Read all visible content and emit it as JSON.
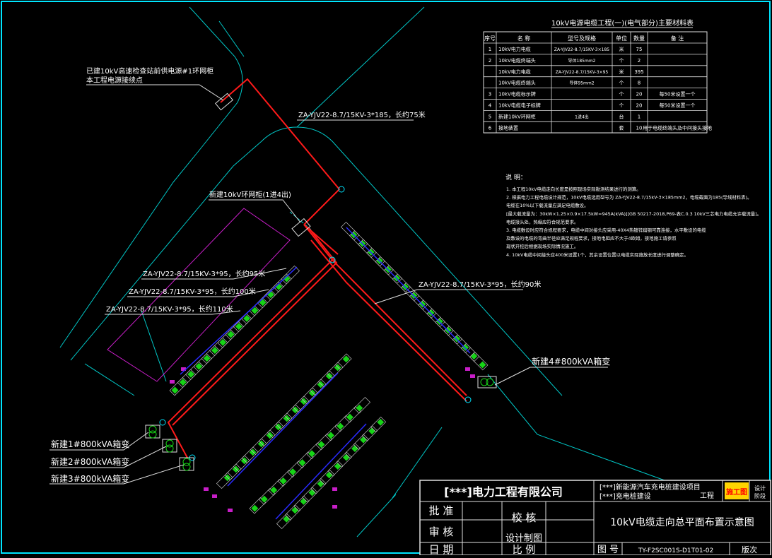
{
  "colors": {
    "background": "#000000",
    "frame": "#00e5ff",
    "road": "#00c8c8",
    "cable": "#ff1a1a",
    "cable_bus": "#2a2aff",
    "parking": "#e0e0e0",
    "charger": "#17d417",
    "site_boundary": "#c81ec8",
    "text": "#ffffff",
    "callout": "#ffff66",
    "stamp_fill": "#ffd400",
    "stamp_text": "#ff0000"
  },
  "labels": {
    "existing_ring_main": [
      "已建10kV高速检查站前供电源#1环网柜",
      "本工程电源接续点"
    ],
    "cable_main": "ZA-YJV22-8.7/15KV-3*185，长约75米",
    "new_ring_main": "新建10kV环网柜(1进4出)",
    "cable_a": "ZA-YJV22-8.7/15KV-3*95，长约95米",
    "cable_b": "ZA-YJV22-8.7/15KV-3*95，长约100米",
    "cable_c": "ZA-YJV22-8.7/15KV-3*95，长约110米",
    "cable_d": "ZA-YJV22-8.7/15KV-3*95，长约90米",
    "transformer_4": "新建4#800kVA箱变",
    "transformer_1": "新建1#800kVA箱变",
    "transformer_2": "新建2#800kVA箱变",
    "transformer_3": "新建3#800kVA箱变"
  },
  "material_table": {
    "title": "10kV电源电缆工程(一)(电气部分)主要材料表",
    "headers": [
      "序号",
      "名 称",
      "型号及规格",
      "单位",
      "数量",
      "备 注"
    ],
    "rows": [
      [
        "1",
        "10kV电力电缆",
        "ZA-YJV22-8.7/15KV-3×185",
        "米",
        "75",
        ""
      ],
      [
        "2",
        "10kV电缆终端头",
        "导体185mm2",
        "个",
        "2",
        ""
      ],
      [
        "",
        "10kV电力电缆",
        "ZA-YJV22-8.7/15KV-3×95",
        "米",
        "395",
        ""
      ],
      [
        "",
        "10kV电缆终端头",
        "导体95mm2",
        "个",
        "8",
        ""
      ],
      [
        "3",
        "10kV电缆标示牌",
        "",
        "个",
        "20",
        "每50米设置一个"
      ],
      [
        "4",
        "10kV电缆电子标牌",
        "",
        "个",
        "20",
        "每50米设置一个"
      ],
      [
        "5",
        "新建10kV环网柜",
        "1进4出",
        "台",
        "1",
        ""
      ],
      [
        "6",
        "接地装置",
        "",
        "套",
        "10",
        "用于电缆终端头及中间接头接地"
      ]
    ]
  },
  "notes": {
    "title": "说 明：",
    "lines": [
      "1. 本工程10kV电缆走向长度是按照现场实际勘测结果进行的测算。",
      "2. 根据电力工程电缆设计规范，10kV电缆选用型号为 ZA-YJV22-8.7/15kV-3×185mm2，电缆截面为185(导线材料表)。",
      "   电缆在10%以下载流量应满足电缆敷设。",
      "   [最大载流量为：30kW×1.25×0.9×17.5kW=945A(kVA)][GB 50217-2018,P69-表C.0.3 10kV三芯电力电缆允许载流量]。",
      "   电缆接头处，热缩应符合规范要求。",
      "3. 电缆敷设时应符合规程要求，电缆中间对接头应采用-40X4热镀锌扁钢可靠连接，水平敷设的电缆",
      "   及敷设的电缆的弯曲半径应满足规程要求，接地电阻应不大于4欧姆，接地施工请参照",
      "   现状开挖后根据现场实际情况施工。",
      "4. 10kV电缆中间接头应400米设置1个，其余设置位置以电缆实际施放长度进行调整确定。"
    ]
  },
  "title_block": {
    "company": "[***]电力工程有限公司",
    "project_line1": "[***]新能源汽车充电桩建设项目",
    "project_line2": "[***]充电桩建设",
    "project_suffix": "工程",
    "stage": "施工图",
    "side_stage": [
      "设计",
      "阶段"
    ],
    "approve": "批 准",
    "review": "审 核",
    "check": "校 核",
    "design": "设计制图",
    "date": "日 期",
    "scale": "比 例",
    "drawing_title": "10kV电缆走向总平面布置示意图",
    "drawing_no_label": "图 号",
    "drawing_no": "TY-F2SC001S-D1T01-02",
    "version": "版次"
  }
}
